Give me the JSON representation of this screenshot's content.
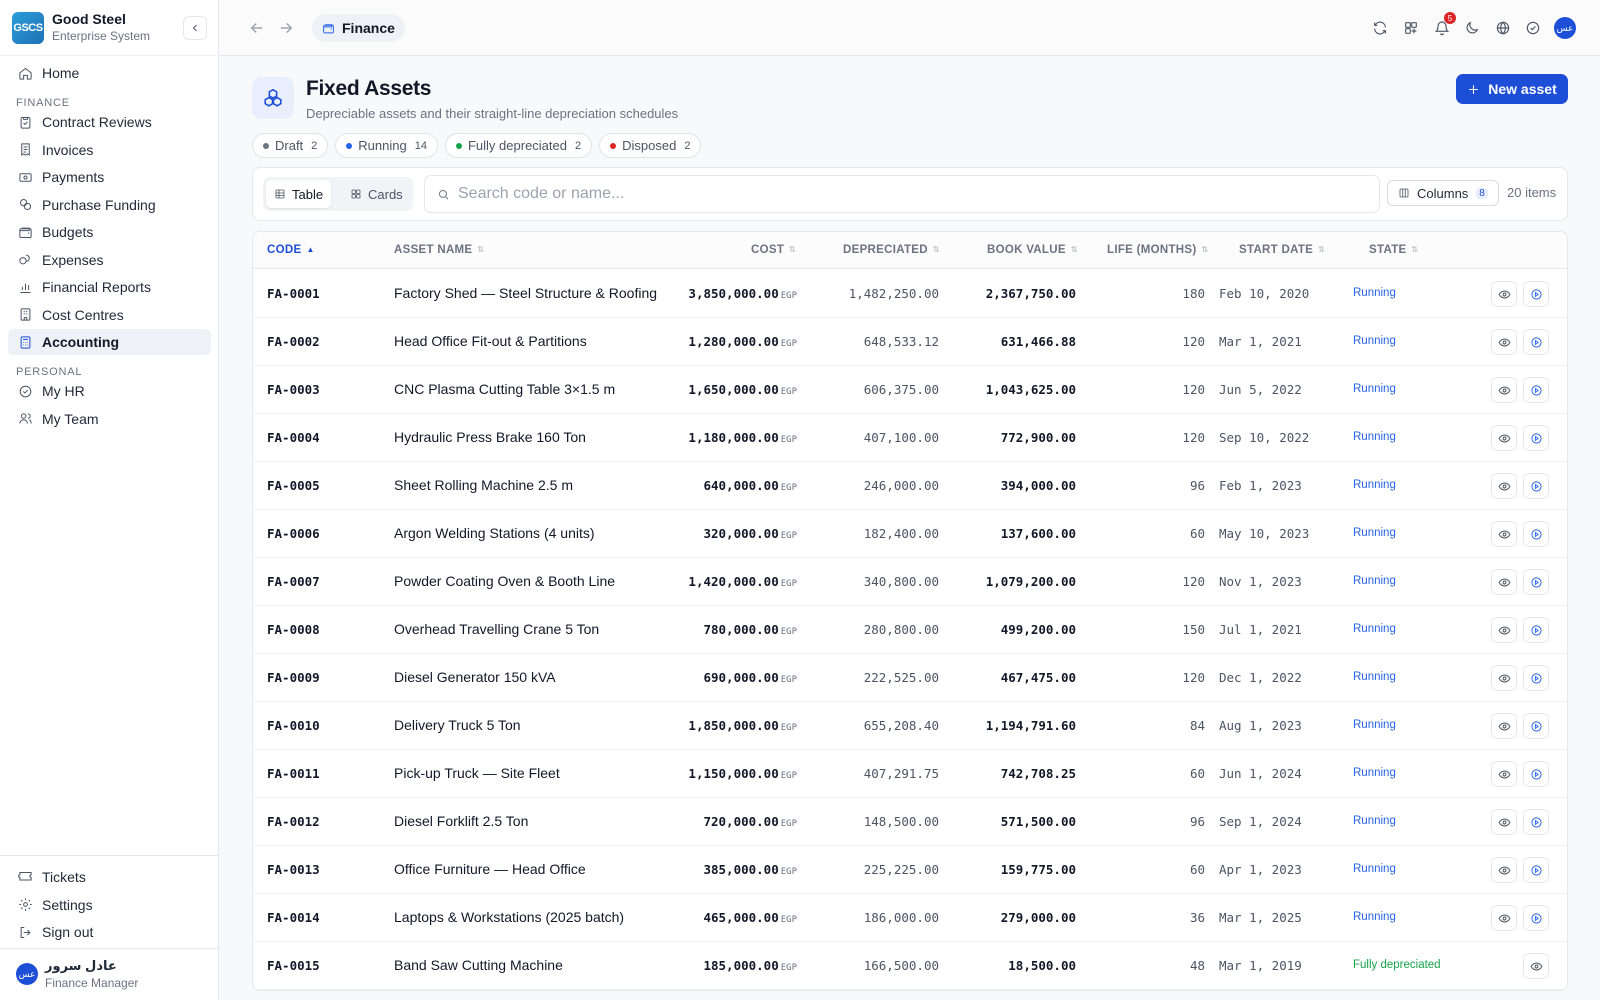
{
  "brand": {
    "logo": "GSCS",
    "name": "Good Steel",
    "subtitle": "Enterprise System"
  },
  "sidebar": {
    "items_top": [
      {
        "label": "Home",
        "icon": "home-icon"
      }
    ],
    "finance_section": "FINANCE",
    "finance_items": [
      {
        "label": "Contract Reviews",
        "icon": "clipboard-check-icon"
      },
      {
        "label": "Invoices",
        "icon": "receipt-icon"
      },
      {
        "label": "Payments",
        "icon": "banknote-icon"
      },
      {
        "label": "Purchase Funding",
        "icon": "coins-icon"
      },
      {
        "label": "Budgets",
        "icon": "wallet-icon"
      },
      {
        "label": "Expenses",
        "icon": "coins-stack-icon"
      },
      {
        "label": "Financial Reports",
        "icon": "bar-chart-icon"
      },
      {
        "label": "Cost Centres",
        "icon": "building-icon"
      },
      {
        "label": "Accounting",
        "icon": "calculator-icon",
        "active": true
      }
    ],
    "personal_section": "PERSONAL",
    "personal_items": [
      {
        "label": "My HR",
        "icon": "check-circle-icon"
      },
      {
        "label": "My Team",
        "icon": "users-icon"
      }
    ],
    "bottom_items": [
      {
        "label": "Tickets",
        "icon": "ticket-icon"
      },
      {
        "label": "Settings",
        "icon": "gear-icon"
      },
      {
        "label": "Sign out",
        "icon": "sign-out-icon"
      }
    ],
    "user": {
      "initials": "عس",
      "name": "عادل سرور",
      "role": "Finance Manager"
    }
  },
  "topbar": {
    "breadcrumb": "Finance",
    "notifications_count": "5",
    "avatar_initials": "عس"
  },
  "header": {
    "title": "Fixed Assets",
    "subtitle": "Depreciable assets and their straight-line depreciation schedules",
    "new_button": "New asset"
  },
  "status_chips": [
    {
      "label": "Draft",
      "count": "2",
      "color": "#6b7280"
    },
    {
      "label": "Running",
      "count": "14",
      "color": "#2563eb"
    },
    {
      "label": "Fully depreciated",
      "count": "2",
      "color": "#16a34a"
    },
    {
      "label": "Disposed",
      "count": "2",
      "color": "#dc2626"
    }
  ],
  "toolbar": {
    "view_table": "Table",
    "view_cards": "Cards",
    "search_placeholder": "Search code or name...",
    "columns_label": "Columns",
    "columns_count": "8",
    "items_count": "20 items"
  },
  "table": {
    "columns": [
      "CODE",
      "ASSET NAME",
      "COST",
      "DEPRECIATED",
      "BOOK VALUE",
      "LIFE (MONTHS)",
      "START DATE",
      "STATE"
    ],
    "currency": "EGP",
    "rows": [
      {
        "code": "FA-0001",
        "name": "Factory Shed — Steel Structure & Roofing",
        "cost": "3,850,000.00",
        "depreciated": "1,482,250.00",
        "book": "2,367,750.00",
        "life": "180",
        "start": "Feb 10, 2020",
        "state": "Running"
      },
      {
        "code": "FA-0002",
        "name": "Head Office Fit-out & Partitions",
        "cost": "1,280,000.00",
        "depreciated": "648,533.12",
        "book": "631,466.88",
        "life": "120",
        "start": "Mar 1, 2021",
        "state": "Running"
      },
      {
        "code": "FA-0003",
        "name": "CNC Plasma Cutting Table 3×1.5 m",
        "cost": "1,650,000.00",
        "depreciated": "606,375.00",
        "book": "1,043,625.00",
        "life": "120",
        "start": "Jun 5, 2022",
        "state": "Running"
      },
      {
        "code": "FA-0004",
        "name": "Hydraulic Press Brake 160 Ton",
        "cost": "1,180,000.00",
        "depreciated": "407,100.00",
        "book": "772,900.00",
        "life": "120",
        "start": "Sep 10, 2022",
        "state": "Running"
      },
      {
        "code": "FA-0005",
        "name": "Sheet Rolling Machine 2.5 m",
        "cost": "640,000.00",
        "depreciated": "246,000.00",
        "book": "394,000.00",
        "life": "96",
        "start": "Feb 1, 2023",
        "state": "Running"
      },
      {
        "code": "FA-0006",
        "name": "Argon Welding Stations (4 units)",
        "cost": "320,000.00",
        "depreciated": "182,400.00",
        "book": "137,600.00",
        "life": "60",
        "start": "May 10, 2023",
        "state": "Running"
      },
      {
        "code": "FA-0007",
        "name": "Powder Coating Oven & Booth Line",
        "cost": "1,420,000.00",
        "depreciated": "340,800.00",
        "book": "1,079,200.00",
        "life": "120",
        "start": "Nov 1, 2023",
        "state": "Running"
      },
      {
        "code": "FA-0008",
        "name": "Overhead Travelling Crane 5 Ton",
        "cost": "780,000.00",
        "depreciated": "280,800.00",
        "book": "499,200.00",
        "life": "150",
        "start": "Jul 1, 2021",
        "state": "Running"
      },
      {
        "code": "FA-0009",
        "name": "Diesel Generator 150 kVA",
        "cost": "690,000.00",
        "depreciated": "222,525.00",
        "book": "467,475.00",
        "life": "120",
        "start": "Dec 1, 2022",
        "state": "Running"
      },
      {
        "code": "FA-0010",
        "name": "Delivery Truck 5 Ton",
        "cost": "1,850,000.00",
        "depreciated": "655,208.40",
        "book": "1,194,791.60",
        "life": "84",
        "start": "Aug 1, 2023",
        "state": "Running"
      },
      {
        "code": "FA-0011",
        "name": "Pick-up Truck — Site Fleet",
        "cost": "1,150,000.00",
        "depreciated": "407,291.75",
        "book": "742,708.25",
        "life": "60",
        "start": "Jun 1, 2024",
        "state": "Running"
      },
      {
        "code": "FA-0012",
        "name": "Diesel Forklift 2.5 Ton",
        "cost": "720,000.00",
        "depreciated": "148,500.00",
        "book": "571,500.00",
        "life": "96",
        "start": "Sep 1, 2024",
        "state": "Running"
      },
      {
        "code": "FA-0013",
        "name": "Office Furniture — Head Office",
        "cost": "385,000.00",
        "depreciated": "225,225.00",
        "book": "159,775.00",
        "life": "60",
        "start": "Apr 1, 2023",
        "state": "Running"
      },
      {
        "code": "FA-0014",
        "name": "Laptops & Workstations (2025 batch)",
        "cost": "465,000.00",
        "depreciated": "186,000.00",
        "book": "279,000.00",
        "life": "36",
        "start": "Mar 1, 2025",
        "state": "Running"
      },
      {
        "code": "FA-0015",
        "name": "Band Saw Cutting Machine",
        "cost": "185,000.00",
        "depreciated": "166,500.00",
        "book": "18,500.00",
        "life": "48",
        "start": "Mar 1, 2019",
        "state": "Fully depreciated"
      }
    ]
  },
  "colors": {
    "accent": "#1d4ed8",
    "running": "#2563eb",
    "fully_depreciated": "#16a34a"
  }
}
